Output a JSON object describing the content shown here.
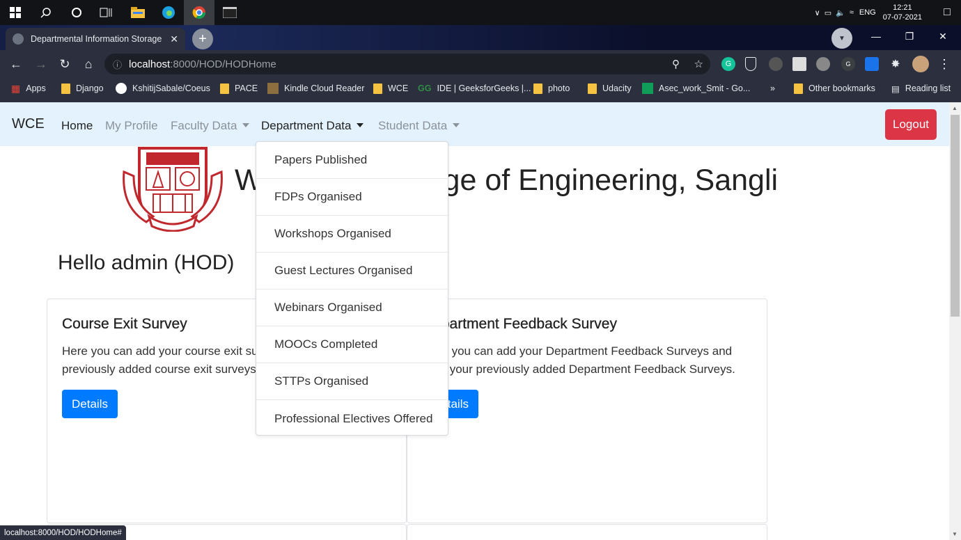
{
  "taskbar": {
    "time": "12:21",
    "date": "07-07-2021",
    "language": "ENG"
  },
  "browser": {
    "tab_title": "Departmental Information Storage a",
    "url_host": "localhost",
    "url_path": ":8000/HOD/HODHome",
    "bookmarks": [
      "Apps",
      "Django",
      "KshitijSabale/Coeus",
      "PACE",
      "Kindle Cloud Reader",
      "WCE",
      "IDE | GeeksforGeeks |...",
      "photo",
      "Udacity",
      "Asec_work_Smit - Go...",
      "»",
      "Other bookmarks",
      "Reading list"
    ],
    "status_url": "localhost:8000/HOD/HODHome#"
  },
  "navbar": {
    "brand": "WCE",
    "links": [
      "Home",
      "My Profile",
      "Faculty Data",
      "Department Data",
      "Student Data"
    ],
    "logout": "Logout"
  },
  "header": {
    "college_name": "Walchand College of Engineering, Sangli",
    "greeting": "Hello admin (HOD)"
  },
  "dropdown": {
    "items": [
      "Papers Published",
      "FDPs Organised",
      "Workshops Organised",
      "Guest Lectures Organised",
      "Webinars Organised",
      "MOOCs Completed",
      "STTPs Organised",
      "Professional Electives Offered"
    ]
  },
  "cards": [
    {
      "title": "Course Exit Survey",
      "text": "Here you can add your course exit surveys and view your previously added course exit surveys.",
      "button": "Details"
    },
    {
      "title": "Department Feedback Survey",
      "text": "Here you can add your Department Feedback Surveys and view your previously added Department Feedback Surveys.",
      "button": "Details"
    }
  ],
  "colors": {
    "navbar_bg": "#e3f2fd",
    "logout": "#dc3545",
    "primary": "#007bff"
  }
}
